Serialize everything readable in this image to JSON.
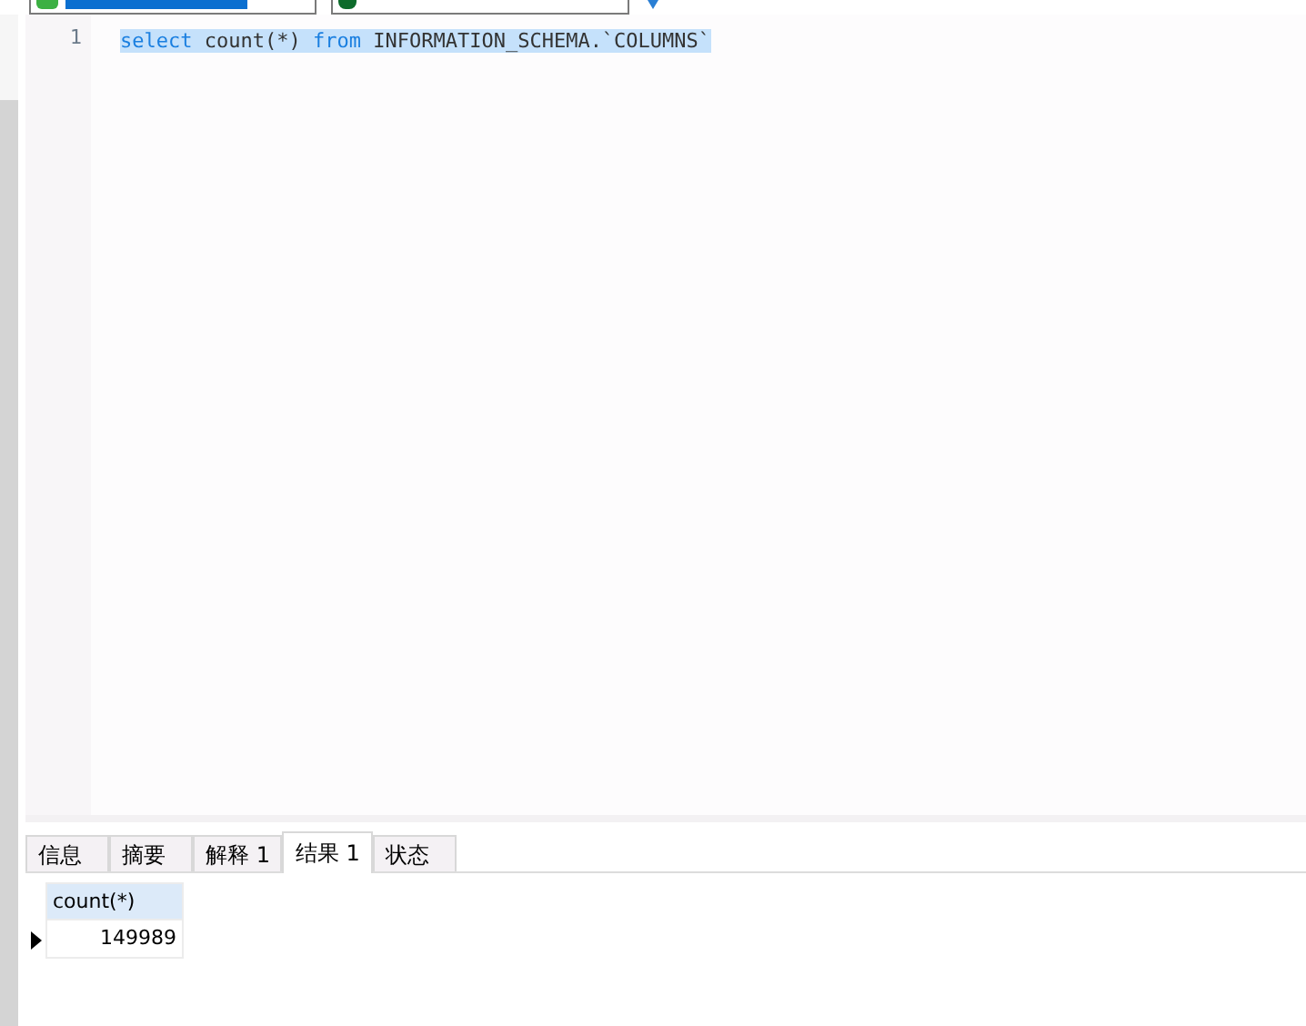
{
  "editor": {
    "lines": [
      {
        "number": "1",
        "selected": true,
        "tokens": [
          {
            "text": "select",
            "kind": "keyword"
          },
          {
            "text": " count(*) ",
            "kind": "plain"
          },
          {
            "text": "from",
            "kind": "keyword"
          },
          {
            "text": " INFORMATION_SCHEMA.`COLUMNS`",
            "kind": "plain"
          }
        ]
      }
    ]
  },
  "result_tabs": [
    {
      "label": "信息",
      "selected": false
    },
    {
      "label": "摘要",
      "selected": false
    },
    {
      "label": "解释 1",
      "selected": false
    },
    {
      "label": "结果 1",
      "selected": true
    },
    {
      "label": "状态",
      "selected": false
    }
  ],
  "result_grid": {
    "columns": [
      "count(*)"
    ],
    "rows": [
      {
        "current": true,
        "cells": [
          "149989"
        ]
      }
    ]
  }
}
